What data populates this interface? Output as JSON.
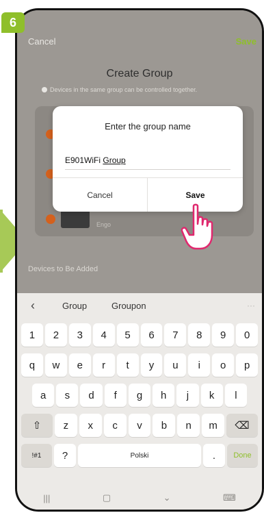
{
  "step": "6",
  "header": {
    "cancel": "Cancel",
    "save": "Save"
  },
  "page": {
    "title": "Create Group",
    "hint": "Devices in the same group can be controlled together."
  },
  "device": {
    "name": "Engo"
  },
  "section": {
    "devices_to_add": "Devices to Be Added"
  },
  "dialog": {
    "title": "Enter the group name",
    "input_prefix": "E901WiFi ",
    "input_underlined": "Group",
    "cancel": "Cancel",
    "save": "Save"
  },
  "keyboard": {
    "suggestions": [
      "Group",
      "Groupon"
    ],
    "more": "···",
    "row_numbers": [
      "1",
      "2",
      "3",
      "4",
      "5",
      "6",
      "7",
      "8",
      "9",
      "0"
    ],
    "row1": [
      "q",
      "w",
      "e",
      "r",
      "t",
      "y",
      "u",
      "i",
      "o",
      "p"
    ],
    "row2": [
      "a",
      "s",
      "d",
      "f",
      "g",
      "h",
      "j",
      "k",
      "l"
    ],
    "row3": [
      "z",
      "x",
      "c",
      "v",
      "b",
      "n",
      "m"
    ],
    "symbols_key": "!#1",
    "question_key": "?",
    "space_label": "Polski",
    "period_key": ".",
    "done_key": "Done"
  },
  "colors": {
    "accent": "#8fbf2b",
    "remove": "#d4611d"
  },
  "icons": [
    "back-chevron-icon",
    "shift-icon",
    "backspace-icon",
    "recent-apps-icon",
    "home-icon",
    "back-icon",
    "keyboard-icon",
    "pointer-hand-icon",
    "info-icon"
  ]
}
